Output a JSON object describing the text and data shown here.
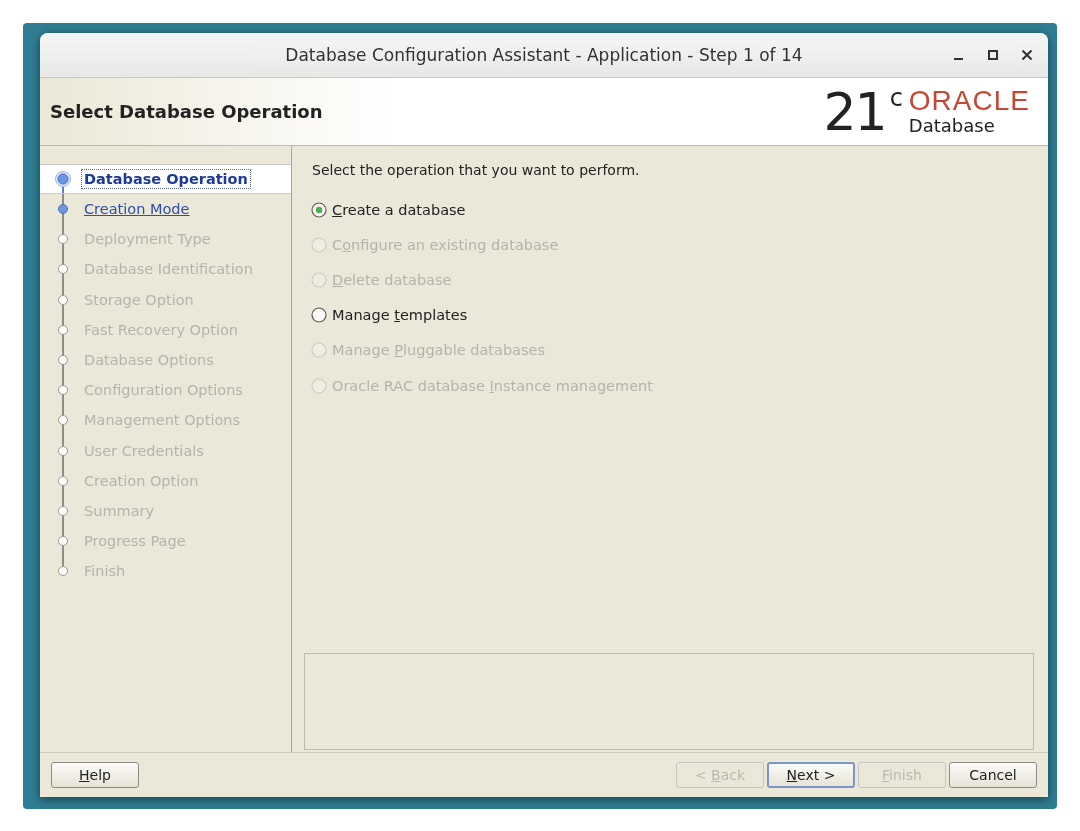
{
  "window": {
    "title": "Database Configuration Assistant - Application - Step 1 of 14"
  },
  "header": {
    "title": "Select Database Operation",
    "logo_version": "21",
    "logo_superscript": "c",
    "logo_brand": "ORACLE",
    "logo_product": "Database"
  },
  "steps": [
    {
      "label": "Database Operation",
      "selected": true,
      "disabled": false
    },
    {
      "label": "Creation Mode",
      "selected": false,
      "disabled": false
    },
    {
      "label": "Deployment Type",
      "selected": false,
      "disabled": true
    },
    {
      "label": "Database Identification",
      "selected": false,
      "disabled": true
    },
    {
      "label": "Storage Option",
      "selected": false,
      "disabled": true
    },
    {
      "label": "Fast Recovery Option",
      "selected": false,
      "disabled": true
    },
    {
      "label": "Database Options",
      "selected": false,
      "disabled": true
    },
    {
      "label": "Configuration Options",
      "selected": false,
      "disabled": true
    },
    {
      "label": "Management Options",
      "selected": false,
      "disabled": true
    },
    {
      "label": "User Credentials",
      "selected": false,
      "disabled": true
    },
    {
      "label": "Creation Option",
      "selected": false,
      "disabled": true
    },
    {
      "label": "Summary",
      "selected": false,
      "disabled": true
    },
    {
      "label": "Progress Page",
      "selected": false,
      "disabled": true
    },
    {
      "label": "Finish",
      "selected": false,
      "disabled": true
    }
  ],
  "prompt": "Select the operation that you want to perform.",
  "options": [
    {
      "mnemonic": "C",
      "label_rest": "reate a database",
      "selected": true,
      "disabled": false
    },
    {
      "label_start": "C",
      "mnemonic": "o",
      "label_rest": "nfigure an existing database",
      "selected": false,
      "disabled": true
    },
    {
      "mnemonic": "D",
      "label_rest": "elete database",
      "selected": false,
      "disabled": true
    },
    {
      "label_start": "Manage ",
      "mnemonic": "t",
      "label_rest": "emplates",
      "selected": false,
      "disabled": false
    },
    {
      "label_start": "Manage ",
      "mnemonic": "P",
      "label_rest": "luggable databases",
      "selected": false,
      "disabled": true
    },
    {
      "label_start": "Oracle RAC database ",
      "mnemonic": "I",
      "label_rest": "nstance management",
      "selected": false,
      "disabled": true
    }
  ],
  "buttons": [
    {
      "mnemonic": "H",
      "label_rest": "elp",
      "disabled": false,
      "default": false
    },
    {
      "label_start": "< ",
      "mnemonic": "B",
      "label_rest": "ack",
      "disabled": true,
      "default": false
    },
    {
      "mnemonic": "N",
      "label_rest": "ext >",
      "disabled": false,
      "default": true
    },
    {
      "mnemonic": "F",
      "label_rest": "inish",
      "disabled": true,
      "default": false
    },
    {
      "label_start": "Cancel",
      "disabled": false,
      "default": false
    }
  ]
}
